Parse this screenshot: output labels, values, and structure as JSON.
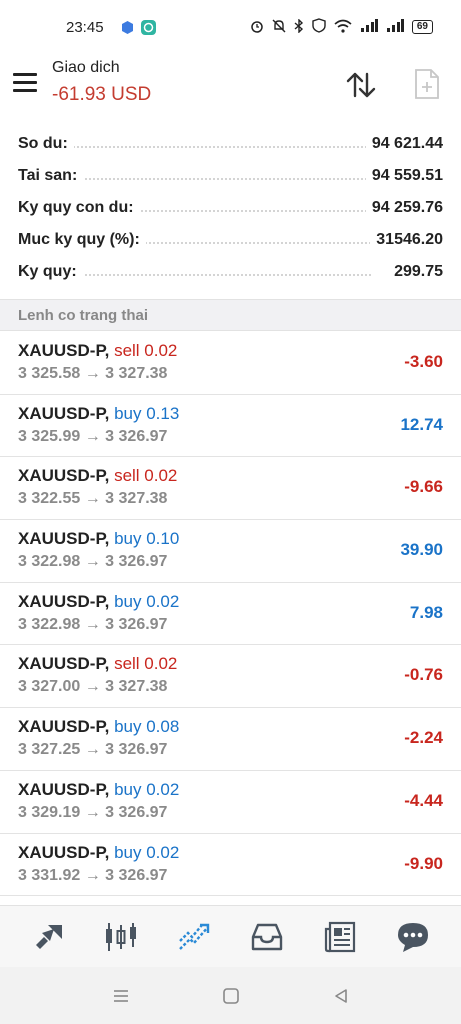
{
  "status_bar": {
    "time": "23:45",
    "battery": "69",
    "icons": [
      "alarm-icon",
      "mute-icon",
      "bluetooth-icon",
      "shield-icon",
      "wifi-icon",
      "signal-icon",
      "signal-icon",
      "battery-icon"
    ]
  },
  "header": {
    "title": "Giao dich",
    "profit": "-61.93 USD"
  },
  "summary": [
    {
      "label": "So du:",
      "value": "94 621.44"
    },
    {
      "label": "Tai san:",
      "value": "94 559.51"
    },
    {
      "label": "Ky quy con du:",
      "value": "94 259.76"
    },
    {
      "label": "Muc ky quy (%):",
      "value": "31546.20"
    },
    {
      "label": "Ky quy:",
      "value": "299.75"
    }
  ],
  "section_title": "Lenh co trang thai",
  "positions": [
    {
      "symbol": "XAUUSD-P,",
      "side": "sell 0.02",
      "type": "sell",
      "prices": "3 325.58 → 3 327.38",
      "profit": "-3.60"
    },
    {
      "symbol": "XAUUSD-P,",
      "side": "buy 0.13",
      "type": "buy",
      "prices": "3 325.99 → 3 326.97",
      "profit": "12.74"
    },
    {
      "symbol": "XAUUSD-P,",
      "side": "sell 0.02",
      "type": "sell",
      "prices": "3 322.55 → 3 327.38",
      "profit": "-9.66"
    },
    {
      "symbol": "XAUUSD-P,",
      "side": "buy 0.10",
      "type": "buy",
      "prices": "3 322.98 → 3 326.97",
      "profit": "39.90"
    },
    {
      "symbol": "XAUUSD-P,",
      "side": "buy 0.02",
      "type": "buy",
      "prices": "3 322.98 → 3 326.97",
      "profit": "7.98"
    },
    {
      "symbol": "XAUUSD-P,",
      "side": "sell 0.02",
      "type": "sell",
      "prices": "3 327.00 → 3 327.38",
      "profit": "-0.76"
    },
    {
      "symbol": "XAUUSD-P,",
      "side": "buy 0.08",
      "type": "buy",
      "prices": "3 327.25 → 3 326.97",
      "profit": "-2.24"
    },
    {
      "symbol": "XAUUSD-P,",
      "side": "buy 0.02",
      "type": "buy",
      "prices": "3 329.19 → 3 326.97",
      "profit": "-4.44"
    },
    {
      "symbol": "XAUUSD-P,",
      "side": "buy 0.02",
      "type": "buy",
      "prices": "3 331.92 → 3 326.97",
      "profit": "-9.90"
    }
  ],
  "tabs": [
    "quotes-icon",
    "chart-icon",
    "trade-icon",
    "history-icon",
    "news-icon",
    "messages-icon"
  ],
  "colors": {
    "sell": "#c8261e",
    "buy": "#1a73c8",
    "profit_header": "#c43c30",
    "active_tab": "#2b8ad6",
    "inactive_tab": "#4a5561"
  }
}
